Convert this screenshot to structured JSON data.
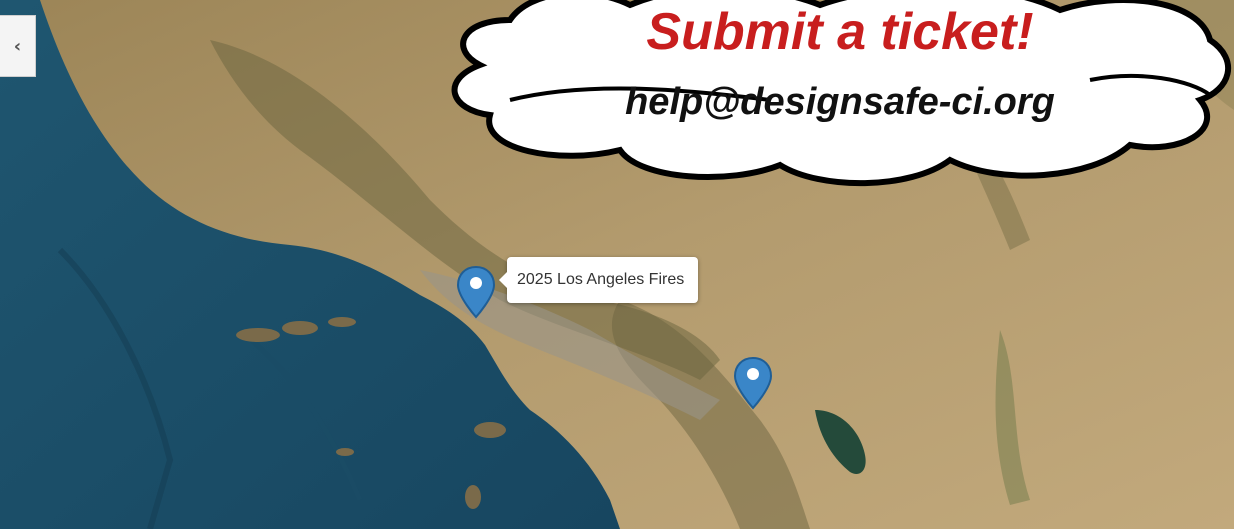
{
  "sidebar": {
    "toggle_icon": "chevron-left-icon",
    "toggle_glyph": "‹"
  },
  "map": {
    "markers": [
      {
        "label": "2025 Los Angeles Fires",
        "has_tooltip": true
      },
      {
        "label": "",
        "has_tooltip": false
      }
    ],
    "marker_color": "#3a86c8"
  },
  "banner": {
    "title": "Submit a ticket!",
    "email": "help@designsafe-ci.org",
    "title_color": "#c81e1e"
  }
}
